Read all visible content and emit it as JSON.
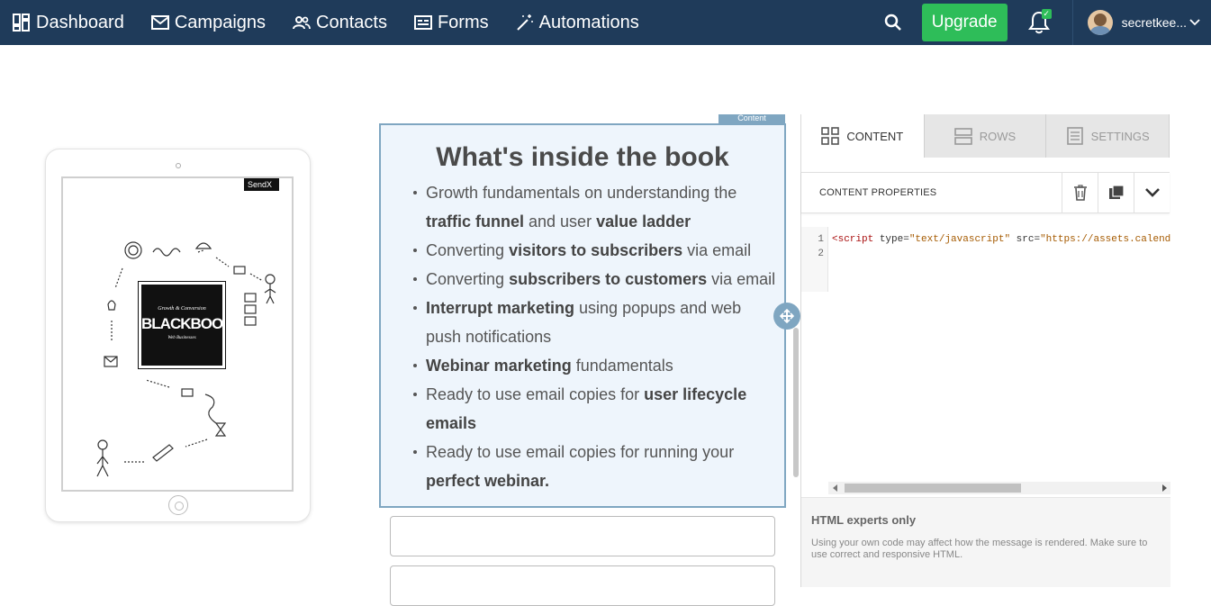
{
  "nav": {
    "items": [
      {
        "label": "Dashboard",
        "icon": "dashboard-icon"
      },
      {
        "label": "Campaigns",
        "icon": "envelope-icon"
      },
      {
        "label": "Contacts",
        "icon": "people-icon"
      },
      {
        "label": "Forms",
        "icon": "form-icon"
      },
      {
        "label": "Automations",
        "icon": "magic-wand-icon"
      }
    ],
    "upgrade_label": "Upgrade",
    "bell_badge": "✓",
    "username": "secretkee..."
  },
  "preview": {
    "sendx_tag": "SendX",
    "book_subtitle": "Growth & Conversion",
    "book_title": "BLACKBOOK",
    "book_caption": "Web Businesses"
  },
  "content": {
    "tag_label": "Content",
    "heading": "What's inside the book",
    "bullets": [
      {
        "pre": "Growth fundamentals on understanding the ",
        "b1": "traffic funnel",
        "mid": " and user ",
        "b2": "value ladder",
        "post": ""
      },
      {
        "pre": "Converting ",
        "b1": "visitors to subscribers",
        "mid": " via email",
        "b2": "",
        "post": ""
      },
      {
        "pre": "Converting ",
        "b1": "subscribers to customers",
        "mid": " via email",
        "b2": "",
        "post": ""
      },
      {
        "pre": "",
        "b1": "Interrupt marketing",
        "mid": " using popups and web push notifications",
        "b2": "",
        "post": ""
      },
      {
        "pre": "",
        "b1": "Webinar marketing",
        "mid": " fundamentals",
        "b2": "",
        "post": ""
      },
      {
        "pre": "Ready to use email copies for ",
        "b1": "user lifecycle emails",
        "mid": "",
        "b2": "",
        "post": ""
      },
      {
        "pre": "Ready to use email copies for running your ",
        "b1": "perfect webinar.",
        "mid": "",
        "b2": "",
        "post": ""
      }
    ]
  },
  "panel": {
    "tabs": [
      {
        "label": "CONTENT",
        "active": true
      },
      {
        "label": "ROWS",
        "active": false
      },
      {
        "label": "SETTINGS",
        "active": false
      }
    ],
    "props_title": "CONTENT PROPERTIES",
    "code": {
      "line_numbers": [
        "1",
        "2"
      ],
      "tag_open": "<script",
      "attr_type": " type=",
      "type_value": "\"text/javascript\"",
      "attr_src": " src=",
      "src_value": "\"https://assets.calendly.com/assets/external/widget.js\""
    },
    "experts_title": "HTML experts only",
    "experts_text": "Using your own code may affect how the message is rendered. Make sure to use correct and responsive HTML."
  },
  "colors": {
    "nav_bg": "#1f3b5a",
    "upgrade_green": "#2ebd59",
    "selection_blue": "#7fa6c1",
    "content_bg": "#eef5fc"
  }
}
